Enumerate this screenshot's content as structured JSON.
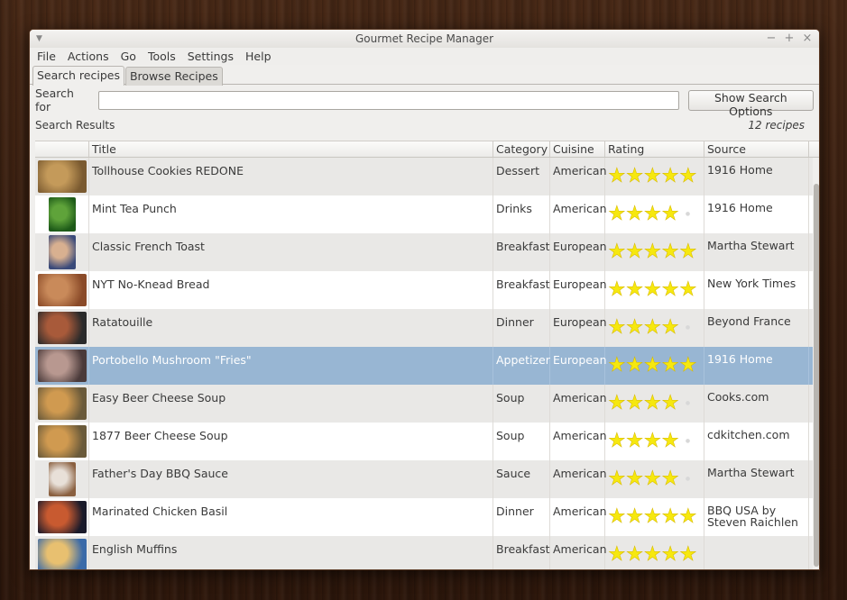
{
  "window": {
    "title": "Gourmet Recipe Manager",
    "buttons": [
      "−",
      "+",
      "×"
    ]
  },
  "menubar": [
    "File",
    "Actions",
    "Go",
    "Tools",
    "Settings",
    "Help"
  ],
  "tabs": [
    {
      "label": "Search recipes",
      "active": true
    },
    {
      "label": "Browse Recipes",
      "active": false
    }
  ],
  "search": {
    "label": "Search for",
    "value": "",
    "placeholder": "",
    "options_button": "Show Search Options"
  },
  "results": {
    "label": "Search Results",
    "count": "12 recipes",
    "columns": [
      "",
      "Title",
      "Category",
      "Cuisine",
      "Rating",
      "Source"
    ],
    "rows": [
      {
        "title": "Tollhouse Cookies REDONE",
        "category": "Dessert",
        "cuisine": "American",
        "rating": 5,
        "source": "1916 Home",
        "thumb": "cookies",
        "colors": [
          "#7a5a30",
          "#c49a5a"
        ]
      },
      {
        "title": "Mint Tea Punch",
        "category": "Drinks",
        "cuisine": "American",
        "rating": 4,
        "source": "1916 Home",
        "thumb": "mint",
        "colors": [
          "#1d5a18",
          "#5fa33a"
        ]
      },
      {
        "title": "Classic French Toast",
        "category": "Breakfast",
        "cuisine": "European",
        "rating": 5,
        "source": "Martha Stewart",
        "thumb": "toast",
        "colors": [
          "#3a4a7a",
          "#d8b090"
        ]
      },
      {
        "title": "NYT No-Knead Bread",
        "category": "Breakfast",
        "cuisine": "European",
        "rating": 5,
        "source": "New York Times",
        "thumb": "bread",
        "colors": [
          "#8a4a28",
          "#c98a5a"
        ]
      },
      {
        "title": "Ratatouille",
        "category": "Dinner",
        "cuisine": "European",
        "rating": 4,
        "source": "Beyond France",
        "thumb": "ratatouille",
        "colors": [
          "#2a2a2a",
          "#a85a3a"
        ]
      },
      {
        "title": "Portobello Mushroom \"Fries\"",
        "category": "Appetizer",
        "cuisine": "European",
        "rating": 5,
        "source": "1916 Home",
        "thumb": "mushroom",
        "colors": [
          "#4a3a3a",
          "#b89890"
        ],
        "selected": true
      },
      {
        "title": "Easy Beer Cheese Soup",
        "category": "Soup",
        "cuisine": "American",
        "rating": 4,
        "source": "Cooks.com",
        "thumb": "soup",
        "colors": [
          "#6a5a3a",
          "#d09a50"
        ]
      },
      {
        "title": "1877 Beer Cheese Soup",
        "category": "Soup",
        "cuisine": "American",
        "rating": 4,
        "source": "cdkitchen.com",
        "thumb": "soup2",
        "colors": [
          "#6a5a3a",
          "#d09a50"
        ]
      },
      {
        "title": "Father's Day BBQ Sauce",
        "category": "Sauce",
        "cuisine": "American",
        "rating": 4,
        "source": "Martha Stewart",
        "thumb": "sauce",
        "colors": [
          "#8a6040",
          "#e8e0d8"
        ]
      },
      {
        "title": "Marinated Chicken Basil",
        "category": "Dinner",
        "cuisine": "American",
        "rating": 5,
        "source": "BBQ USA by Steven Raichlen",
        "thumb": "chicken",
        "colors": [
          "#1a1a2a",
          "#c85a30"
        ]
      },
      {
        "title": "English Muffins",
        "category": "Breakfast",
        "cuisine": "American",
        "rating": 5,
        "source": "",
        "thumb": "muffins",
        "colors": [
          "#3a6aa8",
          "#e8c070"
        ]
      }
    ]
  }
}
